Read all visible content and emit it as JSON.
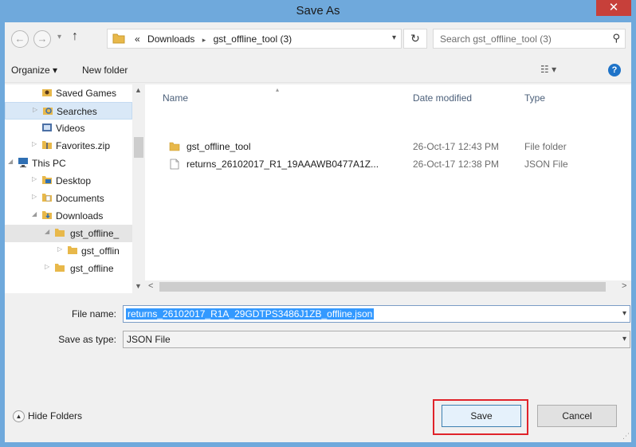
{
  "window": {
    "title": "Save As",
    "close_glyph": "✕"
  },
  "nav": {
    "back_glyph": "←",
    "forward_glyph": "→",
    "history_glyph": "▾",
    "up_glyph": "↑",
    "breadcrumb": [
      "«",
      "Downloads",
      "▸",
      "gst_offline_tool (3)"
    ],
    "dropdown_glyph": "▾",
    "refresh_glyph": "↻",
    "search_placeholder": "Search gst_offline_tool (3)",
    "search_glyph": "⚲"
  },
  "toolbar": {
    "organize": "Organize ▾",
    "new_folder": "New folder",
    "view": "☷ ▾",
    "help": "?"
  },
  "sidebar": {
    "items": [
      {
        "label": "Saved Games"
      },
      {
        "label": "Searches"
      },
      {
        "label": "Videos"
      },
      {
        "label": "Favorites.zip"
      },
      {
        "label": "This PC"
      },
      {
        "label": "Desktop"
      },
      {
        "label": "Documents"
      },
      {
        "label": "Downloads"
      },
      {
        "label": "gst_offline_"
      },
      {
        "label": "gst_offlin"
      },
      {
        "label": "gst_offline"
      }
    ],
    "scroll_up": "▲",
    "scroll_down": "▼"
  },
  "file_list": {
    "columns": [
      "Name",
      "Date modified",
      "Type"
    ],
    "sort_glyph": "▴",
    "rows": [
      {
        "name": "gst_offline_tool",
        "date": "26-Oct-17 12:43 PM",
        "type": "File folder"
      },
      {
        "name": "returns_26102017_R1_19AAAWB0477A1Z...",
        "date": "26-Oct-17 12:38 PM",
        "type": "JSON File"
      }
    ],
    "scroll_left": "<",
    "scroll_right": ">"
  },
  "form": {
    "file_name_label": "File name:",
    "file_name_value": "returns_26102017_R1A_29GDTPS3486J1ZB_offline.json",
    "save_type_label": "Save as type:",
    "save_type_value": "JSON File",
    "dropdown_glyph": "▾"
  },
  "footer": {
    "hide_folders": "Hide Folders",
    "hide_glyph": "▲",
    "save": "Save",
    "cancel": "Cancel",
    "grip": "⋰"
  },
  "colors": {
    "titlebar": "#6fa9dc",
    "close": "#c7403a",
    "selection": "#3399ff",
    "highlight": "#e0232a",
    "folder": "#e8b84a"
  }
}
